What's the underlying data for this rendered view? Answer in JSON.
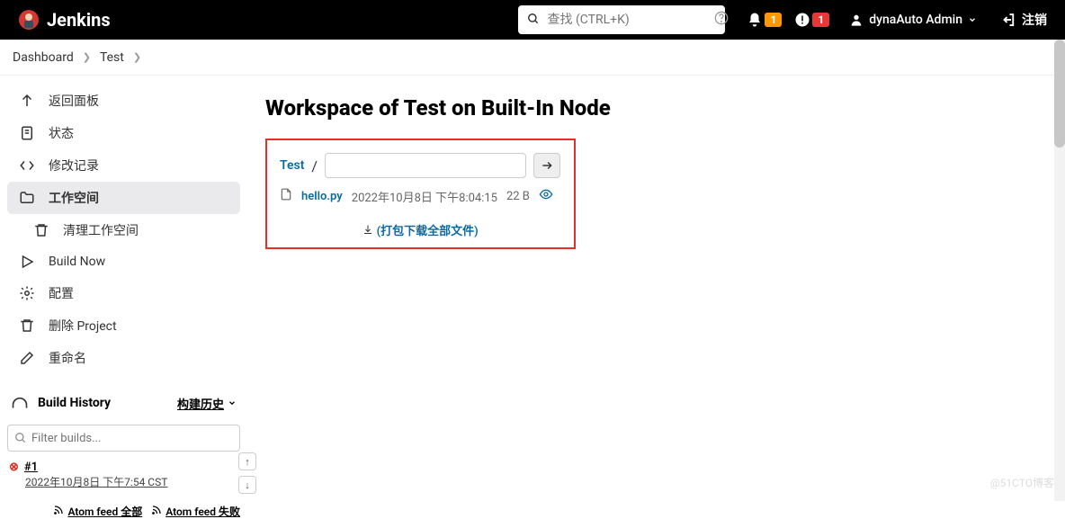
{
  "header": {
    "logo": "Jenkins",
    "search_placeholder": "查找 (CTRL+K)",
    "bell_badge": "1",
    "warn_badge": "1",
    "user_name": "dynaAuto Admin",
    "logout": "注销"
  },
  "breadcrumbs": {
    "items": [
      "Dashboard",
      "Test"
    ]
  },
  "sidebar": {
    "items": [
      {
        "icon": "arrow-up",
        "label": "返回面板"
      },
      {
        "icon": "status",
        "label": "状态"
      },
      {
        "icon": "code",
        "label": "修改记录"
      },
      {
        "icon": "folder",
        "label": "工作空间",
        "active": true
      },
      {
        "icon": "trash",
        "label": "清理工作空间",
        "sub": true
      },
      {
        "icon": "play",
        "label": "Build Now"
      },
      {
        "icon": "gear",
        "label": "配置"
      },
      {
        "icon": "trash",
        "label": "删除 Project"
      },
      {
        "icon": "edit",
        "label": "重命名"
      }
    ],
    "build_history_title": "Build History",
    "build_history_link": "构建历史",
    "filter_placeholder": "Filter builds...",
    "build": {
      "id": "#1",
      "time": "2022年10月8日 下午7:54 CST"
    },
    "atom_all": "Atom feed 全部",
    "atom_fail": "Atom feed 失败"
  },
  "main": {
    "title": "Workspace of Test on Built-In Node",
    "path_link": "Test",
    "file": {
      "name": "hello.py",
      "date": "2022年10月8日 下午8:04:15",
      "size": "22 B"
    },
    "download_all": "(打包下载全部文件)"
  },
  "watermark": "@51CTO博客"
}
